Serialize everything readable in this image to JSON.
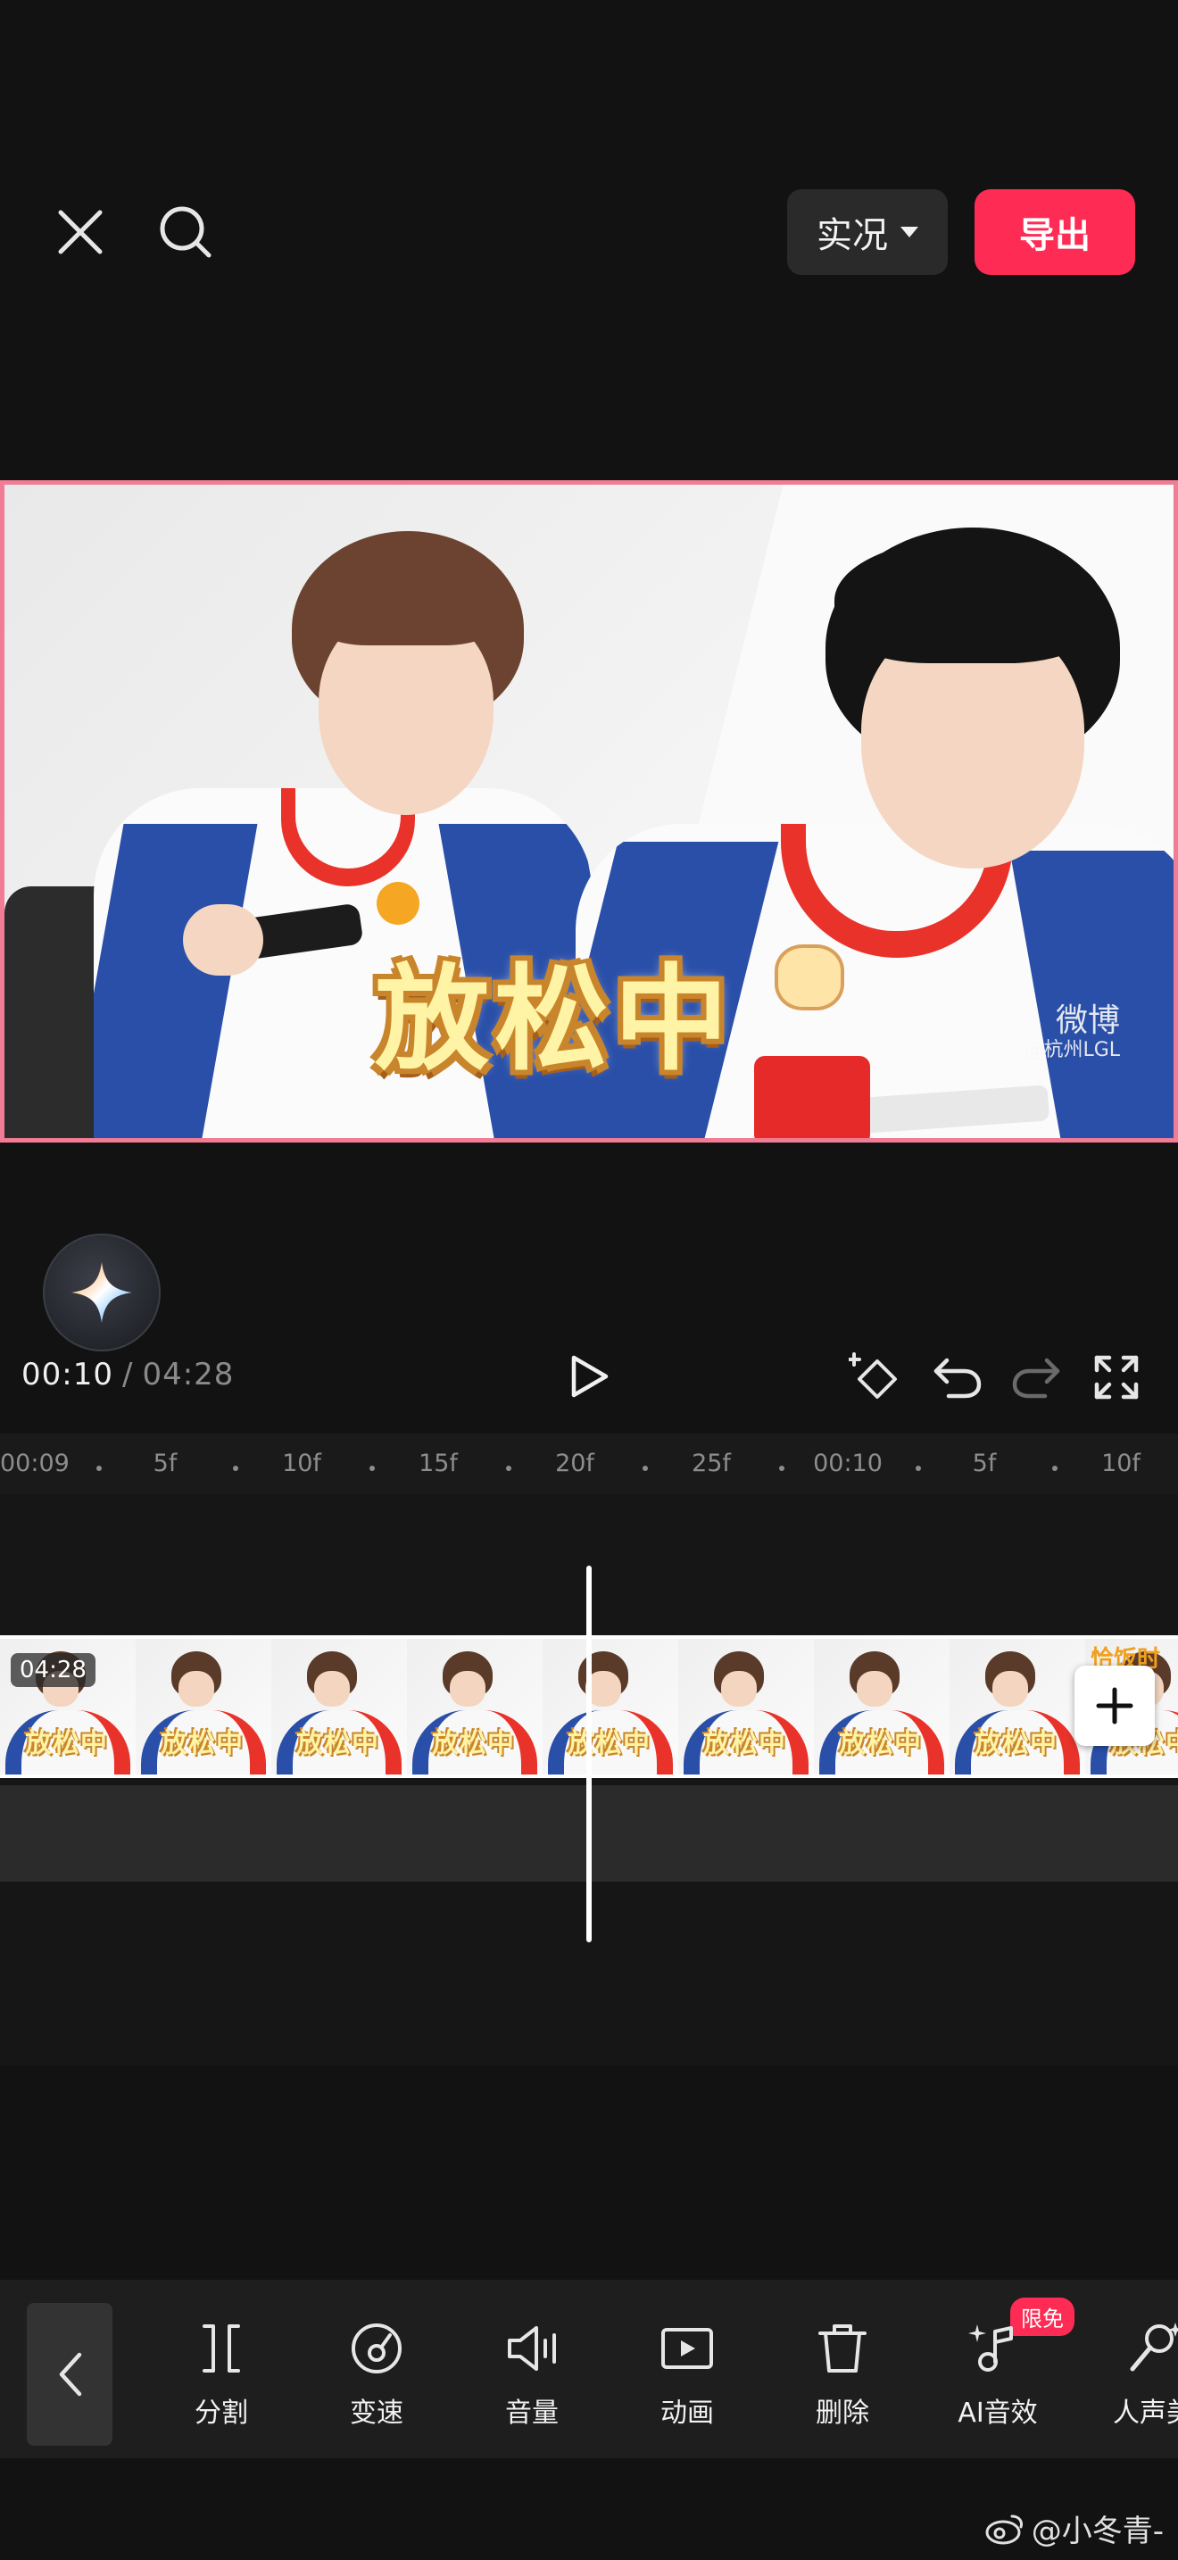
{
  "topbar": {
    "live_label": "实况",
    "export_label": "导出"
  },
  "preview": {
    "caption": "放松中",
    "watermark_brand": "微博",
    "watermark_handle": "@杭州LGL"
  },
  "playback": {
    "current_time": "00:10",
    "separator": "/",
    "total_time": "04:28"
  },
  "ruler": {
    "ticks": [
      "00:09",
      "5f",
      "10f",
      "15f",
      "20f",
      "25f",
      "00:10",
      "5f",
      "10f"
    ]
  },
  "track": {
    "clip_duration": "04:28",
    "frame_caption": "放松中",
    "corner_text": "恰饭时刻"
  },
  "toolbar": {
    "tools": [
      {
        "label": "分割",
        "icon": "split-icon"
      },
      {
        "label": "变速",
        "icon": "speed-icon"
      },
      {
        "label": "音量",
        "icon": "volume-icon"
      },
      {
        "label": "动画",
        "icon": "animation-icon"
      },
      {
        "label": "删除",
        "icon": "delete-icon"
      },
      {
        "label": "AI音效",
        "icon": "ai-sound-icon"
      },
      {
        "label": "人声美",
        "icon": "vocal-beauty-icon"
      }
    ],
    "badge": "限免"
  },
  "footer": {
    "watermark": "@小冬青-"
  },
  "colors": {
    "accent": "#fe2c55",
    "background": "#121212",
    "preview_border": "#f07c95"
  }
}
